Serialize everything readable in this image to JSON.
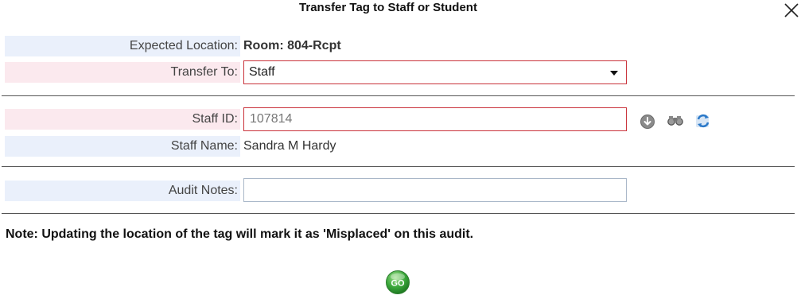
{
  "dialog": {
    "title": "Transfer Tag to Staff or Student"
  },
  "expected_location": {
    "label": "Expected Location:",
    "value": "Room: 804-Rcpt"
  },
  "transfer_to": {
    "label": "Transfer To:",
    "selected": "Staff"
  },
  "staff_id": {
    "label": "Staff ID:",
    "value": "107814"
  },
  "staff_name": {
    "label": "Staff Name:",
    "value": "Sandra M Hardy"
  },
  "audit_notes": {
    "label": "Audit Notes:",
    "value": ""
  },
  "note": "Note: Updating the location of the tag will mark it as 'Misplaced' on this audit.",
  "go_button": {
    "label": "GO"
  },
  "icons": {
    "close": "close-icon",
    "lookup": "arrow-down-circle-icon",
    "search": "binoculars-icon",
    "refresh": "refresh-icon",
    "go": "go-button-icon"
  },
  "colors": {
    "required_border": "#c9323a",
    "label_blue": "#eaf0fb",
    "label_pink": "#fbe9ee",
    "go_green": "#3aa63a"
  }
}
